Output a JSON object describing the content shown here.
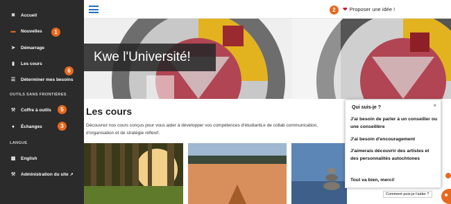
{
  "sidebar": {
    "items": [
      {
        "label": "Accueil",
        "icon": "home-icon"
      },
      {
        "label": "Nouvelles",
        "icon": "news-icon"
      },
      {
        "label": "Démarrage",
        "icon": "rocket-icon"
      },
      {
        "label": "Les cours",
        "icon": "document-icon"
      },
      {
        "label": "Déterminer mes besoins",
        "icon": "list-icon"
      }
    ],
    "section_tools": "OUTILS SANS FRONTIÈRES",
    "tools": [
      {
        "label": "Coffre à outils",
        "icon": "wrench-icon"
      },
      {
        "label": "Échanges",
        "icon": "chat-icon"
      }
    ],
    "section_language": "LANGUE",
    "language": {
      "label": "English",
      "icon": "language-icon"
    },
    "admin": {
      "label": "Administration du site",
      "icon": "wrench-icon"
    }
  },
  "badges": {
    "news": "1",
    "idea": "2",
    "exchanges": "3",
    "tools": "5",
    "courses": "6"
  },
  "topbar": {
    "idea_label": "Proposer une idée !"
  },
  "banner": {
    "title": "Kwe l'Université!"
  },
  "courses": {
    "title": "Les cours",
    "description": "Découvrez nos cours conçus pour vous aider à développer vos compétences d'étudiantLe de collab communication, d'organisation et de stratégie réflexif."
  },
  "chat": {
    "title": "Qui suis-je ?",
    "close": "×",
    "options": [
      "J'ai besoin de parler à un conseiller ou une conseillère",
      "J'ai besoin d'encouragement",
      "J'aimerais découvrir des artistes et des personnalités autochtones",
      "Tout va bien, merci!"
    ],
    "help": "Comment puis-je t'aider ?"
  },
  "colors": {
    "sidebar": "#2b2b2b",
    "accent": "#e8681e",
    "link": "#1c6fc4",
    "heart": "#c8102e"
  }
}
